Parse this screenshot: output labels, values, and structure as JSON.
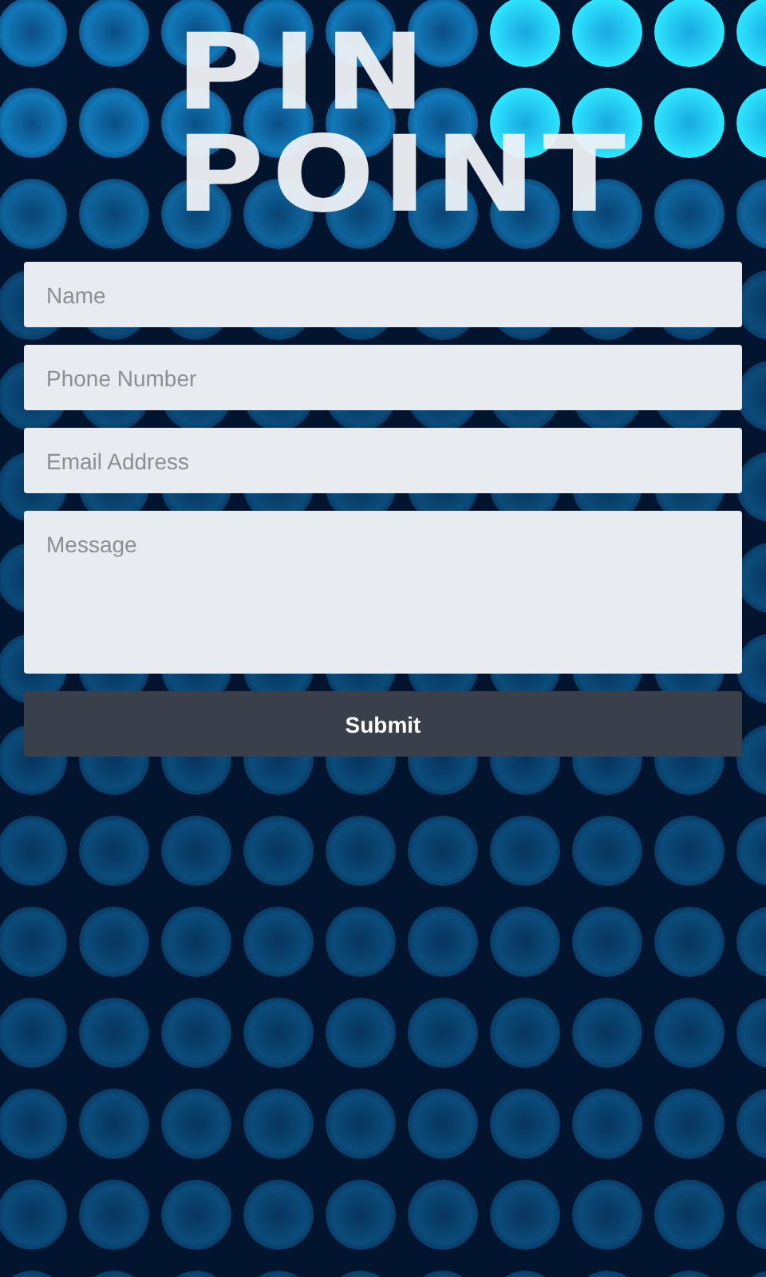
{
  "logo": {
    "lines": [
      "PIN",
      "POINT"
    ]
  },
  "form": {
    "fields": [
      {
        "kind": "input",
        "placeholder": "Name"
      },
      {
        "kind": "input",
        "placeholder": "Phone Number"
      },
      {
        "kind": "input",
        "placeholder": "Email Address"
      },
      {
        "kind": "textarea",
        "placeholder": "Message"
      }
    ],
    "submit": "Submit"
  }
}
